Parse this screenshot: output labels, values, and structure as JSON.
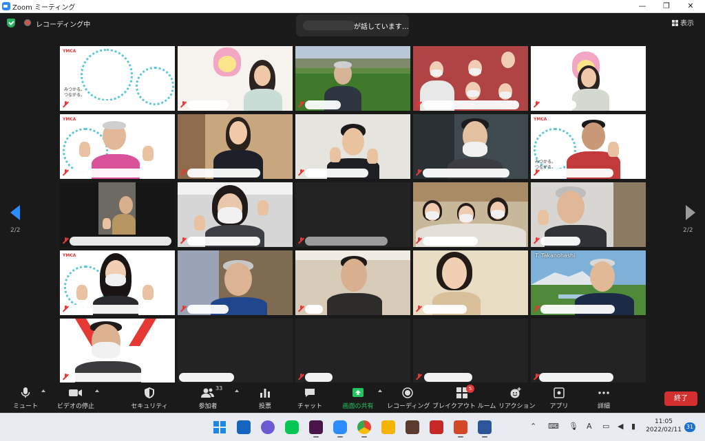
{
  "window": {
    "title": "Zoom ミーティング",
    "minimize": "—",
    "maximize": "❐",
    "close": "✕"
  },
  "meeting": {
    "recording_label": "レコーディング中",
    "speaker_text": "が話しています…",
    "view_label": "表示",
    "page_left": "2/2",
    "page_right": "2/2",
    "tile_named": "T. Takanohashi",
    "ymca_logo": "YMCA",
    "ymca_slogan_line1": "みつかる。",
    "ymca_slogan_line2": "つながる。"
  },
  "toolbar": {
    "mute": "ミュート",
    "video_stop": "ビデオの停止",
    "security": "セキュリティ",
    "participants": "参加者",
    "participants_count": "33",
    "polls": "投票",
    "chat": "チャット",
    "share_screen": "画面の共有",
    "record": "レコーディング",
    "breakout": "ブレイクアウト ルーム",
    "breakout_badge": "5",
    "reactions": "リアクション",
    "apps": "アプリ",
    "more": "詳細",
    "end": "終了"
  },
  "taskbar": {
    "ime_label": "A",
    "time": "11:05",
    "date": "2022/02/11",
    "notification_count": "31"
  },
  "colors": {
    "zoom_blue": "#2d8cff",
    "share_green": "#22c55e",
    "end_red": "#d32f2f",
    "mute_red": "#e53935"
  }
}
